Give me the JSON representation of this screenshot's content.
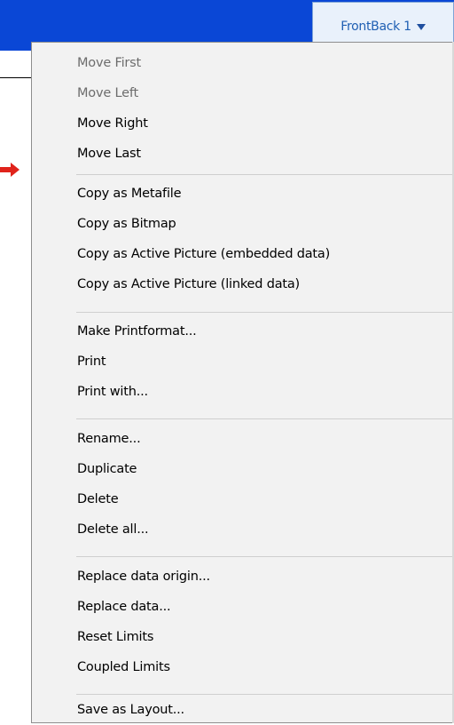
{
  "tab": {
    "label": "FrontBack 1"
  },
  "colors": {
    "header_blue": "#0a47d6",
    "tab_bg": "#e9f1fb",
    "tab_text": "#1f5fb3",
    "menu_bg": "#f2f2f2",
    "arrow_red": "#e0231b"
  },
  "menu": {
    "items": [
      {
        "label": "Move First",
        "enabled": false
      },
      {
        "label": "Move Left",
        "enabled": false
      },
      {
        "label": "Move Right",
        "enabled": true
      },
      {
        "label": "Move Last",
        "enabled": true
      },
      {
        "label": "Copy as Metafile",
        "enabled": true
      },
      {
        "label": "Copy as Bitmap",
        "enabled": true
      },
      {
        "label": "Copy as Active Picture (embedded data)",
        "enabled": true
      },
      {
        "label": "Copy as Active Picture (linked data)",
        "enabled": true
      },
      {
        "label": "Make Printformat...",
        "enabled": true
      },
      {
        "label": "Print",
        "enabled": true
      },
      {
        "label": "Print with...",
        "enabled": true
      },
      {
        "label": "Rename...",
        "enabled": true
      },
      {
        "label": "Duplicate",
        "enabled": true
      },
      {
        "label": "Delete",
        "enabled": true
      },
      {
        "label": "Delete all...",
        "enabled": true
      },
      {
        "label": "Replace data origin...",
        "enabled": true
      },
      {
        "label": "Replace data...",
        "enabled": true
      },
      {
        "label": "Reset Limits",
        "enabled": true
      },
      {
        "label": "Coupled Limits",
        "enabled": true
      },
      {
        "label": "Save as Layout...",
        "enabled": true
      }
    ]
  }
}
